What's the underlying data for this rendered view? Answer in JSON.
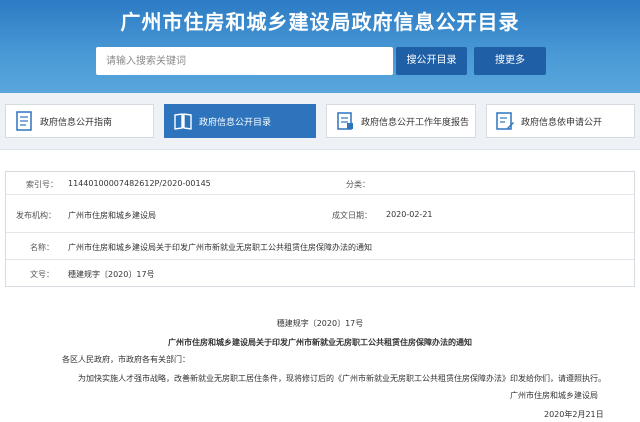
{
  "header": {
    "title": "广州市住房和城乡建设局政府信息公开目录",
    "search_placeholder": "请输入搜索关键词",
    "search_button": "搜公开目录",
    "more_button": "搜更多"
  },
  "nav": [
    {
      "label": "政府信息公开指南",
      "icon": "document-icon",
      "active": false
    },
    {
      "label": "政府信息公开目录",
      "icon": "book-icon",
      "active": true
    },
    {
      "label": "政府信息公开工作年度报告",
      "icon": "report-icon",
      "active": false
    },
    {
      "label": "政府信息依申请公开",
      "icon": "form-icon",
      "active": false
    }
  ],
  "meta": {
    "index_label": "索引号：",
    "index_value": "11440100007482612P/2020-00145",
    "category_label": "分类：",
    "category_value": "",
    "publisher_label": "发布机构：",
    "publisher_value": "广州市住房和城乡建设局",
    "date_label": "成文日期：",
    "date_value": "2020-02-21",
    "name_label": "名称：",
    "name_value": "广州市住房和城乡建设局关于印发广州市新就业无房职工公共租赁住房保障办法的通知",
    "docno_label": "文号：",
    "docno_value": "穗建规字〔2020〕17号"
  },
  "document": {
    "number": "穗建规字〔2020〕17号",
    "title": "广州市住房和城乡建设局关于印发广州市新就业无房职工公共租赁住房保障办法的通知",
    "salutation": "各区人民政府，市政府各有关部门：",
    "body": "为加快实施人才强市战略，改善新就业无房职工居住条件，现将修订后的《广州市新就业无房职工公共租赁住房保障办法》印发给你们，请遵照执行。",
    "signer": "广州市住房和城乡建设局",
    "date": "2020年2月21日"
  }
}
